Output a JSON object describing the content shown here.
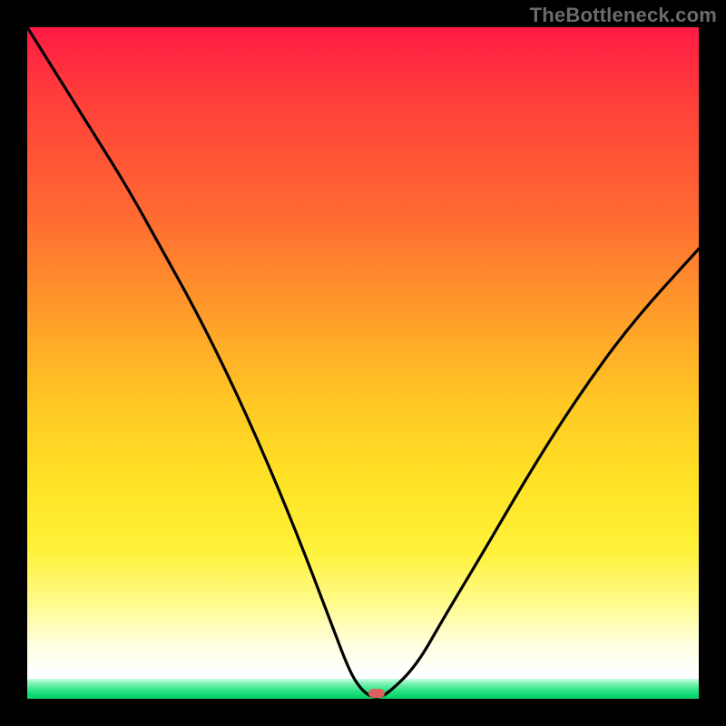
{
  "watermark": "TheBottleneck.com",
  "chart_data": {
    "type": "line",
    "title": "",
    "xlabel": "",
    "ylabel": "",
    "xlim": [
      0,
      100
    ],
    "ylim": [
      0,
      100
    ],
    "grid": false,
    "legend": false,
    "series": [
      {
        "name": "bottleneck-curve",
        "x": [
          0,
          5,
          10,
          15,
          20,
          25,
          30,
          35,
          40,
          45,
          48,
          50,
          52,
          54,
          58,
          62,
          68,
          75,
          82,
          90,
          100
        ],
        "values": [
          100,
          92,
          84,
          76,
          67,
          58,
          48,
          37,
          25,
          12,
          4,
          1,
          0,
          1,
          5,
          12,
          22,
          34,
          45,
          56,
          67
        ]
      }
    ],
    "marker": {
      "x": 52,
      "y": 0,
      "color": "#d9625f",
      "shape": "pill"
    },
    "background_gradient": {
      "top_color": "#ff1a44",
      "mid_color": "#ffe326",
      "bottom_color": "#06d06a"
    }
  }
}
